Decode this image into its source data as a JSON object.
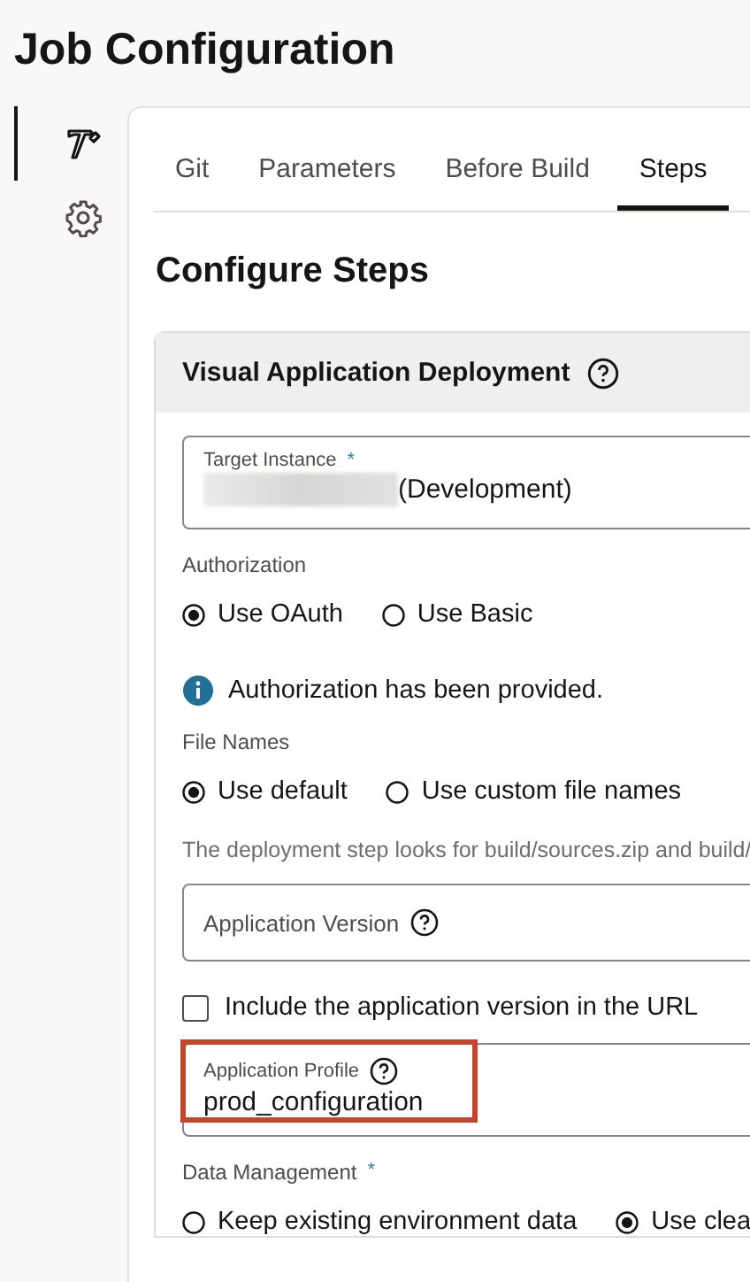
{
  "page_title": "Job Configuration",
  "sidebar": {
    "items": [
      {
        "selected": true
      },
      {
        "selected": false
      }
    ]
  },
  "tabs": [
    {
      "label": "Git",
      "selected": false
    },
    {
      "label": "Parameters",
      "selected": false
    },
    {
      "label": "Before Build",
      "selected": false
    },
    {
      "label": "Steps",
      "selected": true
    }
  ],
  "section_title": "Configure Steps",
  "step": {
    "title": "Visual Application Deployment",
    "fields": [
      {
        "kind": "input",
        "label": "Target Instance",
        "required_mark": "*",
        "redacted": true,
        "value": "(Development)"
      },
      {
        "kind": "radios",
        "label": "Authorization",
        "options": [
          {
            "label": "Use OAuth",
            "selected": true
          },
          {
            "label": "Use Basic",
            "selected": false
          }
        ]
      },
      {
        "kind": "info",
        "text": "Authorization has been provided."
      },
      {
        "kind": "radios",
        "label": "File Names",
        "options": [
          {
            "label": "Use default",
            "selected": true
          },
          {
            "label": "Use custom file names",
            "selected": false
          }
        ]
      },
      {
        "kind": "note",
        "text": "The deployment step looks for build/sources.zip and build/"
      },
      {
        "kind": "input",
        "label": "Application Version",
        "help": true
      },
      {
        "kind": "checkbox",
        "label": "Include the application version in the URL",
        "checked": false
      },
      {
        "kind": "input",
        "label": "Application Profile",
        "help": true,
        "highlighted": true,
        "value": "prod_configuration"
      },
      {
        "kind": "radios",
        "label": "Data Management",
        "required_mark": "*",
        "options": [
          {
            "label": "Keep existing environment data",
            "selected": false
          },
          {
            "label": "Use clea",
            "selected": true
          }
        ]
      }
    ]
  }
}
